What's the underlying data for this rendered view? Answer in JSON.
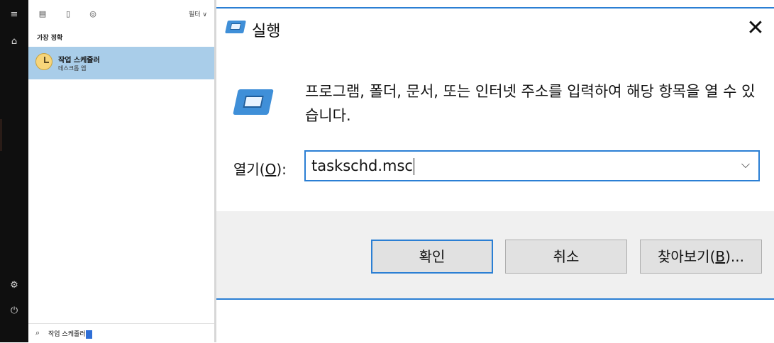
{
  "start_menu": {
    "filter": {
      "more_label": "필터"
    },
    "best_match_heading": "가장 정확",
    "result": {
      "title": "작업 스케줄러",
      "subtitle": "데스크톱 앱"
    },
    "search": {
      "query": "작업 스케줄러"
    }
  },
  "run_dialog": {
    "title": "실행",
    "description": "프로그램, 폴더, 문서, 또는 인터넷 주소를 입력하여 해당 항목을 열 수 있습니다.",
    "open_label_prefix": "열기(",
    "open_label_key": "O",
    "open_label_suffix": "):",
    "open_value": "taskschd.msc",
    "buttons": {
      "ok": "확인",
      "cancel": "취소",
      "browse_prefix": "찾아보기(",
      "browse_key": "B",
      "browse_suffix": ")..."
    }
  },
  "colors": {
    "accent": "#2b7fd4",
    "selected_result": "#a9cde9",
    "taskbar": "#0f0f0f",
    "button_area": "#f0f0f0"
  }
}
